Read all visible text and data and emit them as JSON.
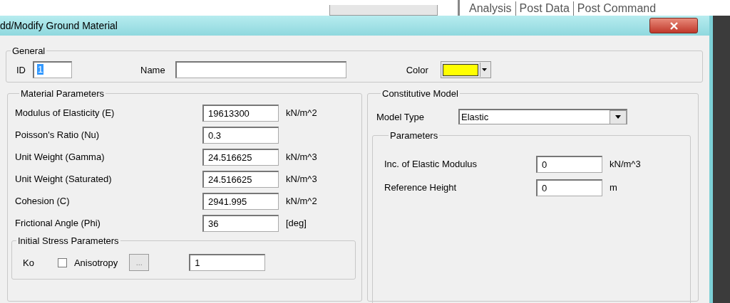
{
  "background_app": {
    "menu": [
      "Analysis",
      "Post Data",
      "Post Command"
    ]
  },
  "dialog": {
    "title": "dd/Modify Ground Material",
    "general": {
      "title": "General",
      "id_label": "ID",
      "id_value": "1",
      "name_label": "Name",
      "color_label": "Color",
      "color": "#ffff00"
    },
    "material_parameters": {
      "title": "Material Parameters",
      "rows": [
        {
          "label": "Modulus of Elasticity (E)",
          "value": "19613300",
          "unit": "kN/m^2"
        },
        {
          "label": "Poisson's Ratio (Nu)",
          "value": "0.3"
        },
        {
          "label": "Unit Weight (Gamma)",
          "value": "24.516625",
          "unit": "kN/m^3"
        },
        {
          "label": "Unit Weight (Saturated)",
          "value": "24.516625",
          "unit": "kN/m^3"
        },
        {
          "label": "Cohesion (C)",
          "value": "2941.995",
          "unit": "kN/m^2"
        },
        {
          "label": "Frictional Angle (Phi)",
          "value": "36",
          "unit": "[deg]"
        }
      ],
      "initial_stress": {
        "title": "Initial Stress Parameters",
        "ko_label": "Ko",
        "anisotropy": {
          "label": "Anisotropy",
          "checked": false
        },
        "browse_button": "...",
        "value": "1"
      }
    },
    "constitutive_model": {
      "title": "Constitutive Model",
      "model_type_label": "Model Type",
      "model_type": "Elastic",
      "parameters": {
        "title": "Parameters",
        "rows": [
          {
            "label": "Inc. of Elastic Modulus",
            "value": "0",
            "unit": "kN/m^3"
          },
          {
            "label": "Reference Height",
            "value": "0",
            "unit": "m"
          }
        ]
      }
    }
  }
}
